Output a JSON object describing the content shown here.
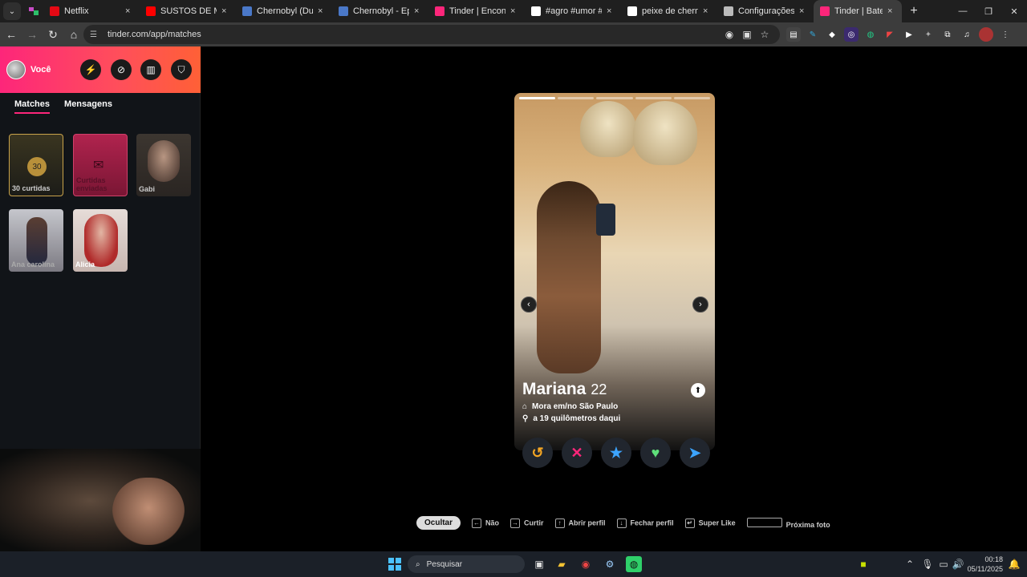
{
  "browser": {
    "tabs": [
      {
        "title": "Netflix",
        "favicon_color": "#e50914",
        "active": false
      },
      {
        "title": "SUSTOS DE MOTO (",
        "favicon_color": "#ff0000",
        "active": false
      },
      {
        "title": "Chernobyl (Dublado",
        "favicon_color": "#4a78c8",
        "active": false
      },
      {
        "title": "Chernobyl - Episódi",
        "favicon_color": "#4a78c8",
        "active": false
      },
      {
        "title": "Tinder | Encontros, /",
        "favicon_color": "#fd267a",
        "active": false
      },
      {
        "title": "#agro #umor #com",
        "favicon_color": "#ffffff",
        "active": false
      },
      {
        "title": "peixe de chernobyl",
        "favicon_color": "#ffffff",
        "active": false
      },
      {
        "title": "Configurações",
        "favicon_color": "#bbbbbb",
        "active": false
      },
      {
        "title": "Tinder | Bate papo.",
        "favicon_color": "#fd267a",
        "active": true
      }
    ],
    "tab_close": "×",
    "new_tab": "+",
    "url": "tinder.com/app/matches"
  },
  "sidebar": {
    "user_label": "Você",
    "sub_tabs": [
      "Matches",
      "Mensagens"
    ],
    "likes_count": "30",
    "likes_label": "30 curtidas",
    "sent_label": "Curtidas enviadas",
    "matches": [
      {
        "name": "Gabi"
      },
      {
        "name": "Ana carolina"
      },
      {
        "name": "Alicia"
      }
    ]
  },
  "profile": {
    "name": "Mariana",
    "age": "22",
    "location": "Mora em/no São Paulo",
    "distance": "a 19 quilômetros daqui"
  },
  "colors": {
    "brand": "#fd267a",
    "rewind": "#f5a623",
    "nope": "#fd267a",
    "superlike": "#3ca4ff",
    "like": "#5fe07a",
    "boost": "#3ca4ff"
  },
  "hints": {
    "hide": "Ocultar",
    "nope": "Não",
    "like": "Curtir",
    "open_profile": "Abrir perfil",
    "close_profile": "Fechar perfil",
    "super_like": "Super Like",
    "next_photo": "Próxima foto"
  },
  "taskbar": {
    "search_placeholder": "Pesquisar",
    "time": "00:18",
    "date": "05/11/2025"
  }
}
